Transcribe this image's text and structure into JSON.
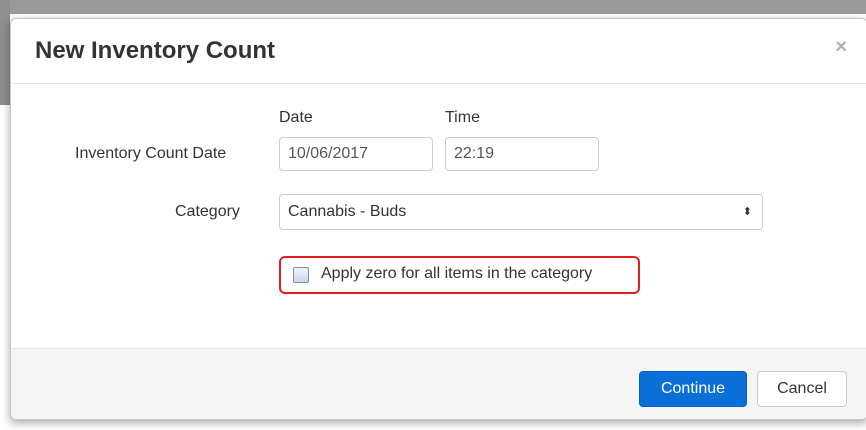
{
  "modal": {
    "title": "New Inventory Count",
    "close_glyph": "×"
  },
  "form": {
    "date_heading": "Date",
    "time_heading": "Time",
    "inventory_count_date_label": "Inventory Count Date",
    "date_value": "10/06/2017",
    "time_value": "22:19",
    "category_label": "Category",
    "category_selected": "Cannabis - Buds",
    "select_arrow_glyph": "⬍",
    "apply_zero_label": "Apply zero for all items in the category",
    "apply_zero_checked": false
  },
  "footer": {
    "continue_label": "Continue",
    "cancel_label": "Cancel"
  },
  "colors": {
    "primary": "#0a6fd8",
    "highlight": "#e02020",
    "footer_bg": "#f5f5f5"
  }
}
